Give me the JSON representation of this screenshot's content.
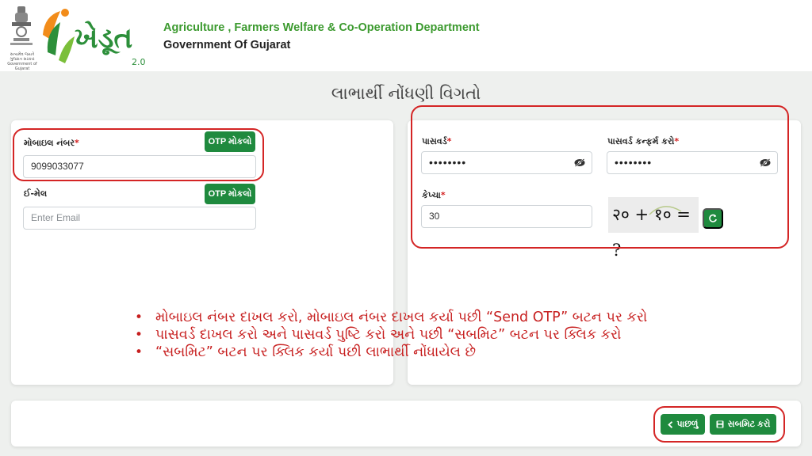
{
  "header": {
    "emblem_caption": "સત્યમેવ જયતે\nગુજરાત સરકાર\nGovernment of Gujarat",
    "logo_text": "ખેડૂત",
    "logo_version": "2.0",
    "department": "Agriculture , Farmers Welfare & Co-Operation Department",
    "government": "Government Of Gujarat"
  },
  "page": {
    "title": "લાભાર્થી નોંધણી વિગતો"
  },
  "form": {
    "mobile": {
      "label": "મોબાઇલ નંબર",
      "required_mark": "*",
      "value": "9099033077",
      "otp_button": "OTP મોકલો"
    },
    "email": {
      "label": "ઈ-મેલ",
      "placeholder": "Enter Email",
      "otp_button": "OTP મોકલો"
    },
    "password": {
      "label": "પાસવર્ડ",
      "required_mark": "*",
      "value": "••••••••"
    },
    "confirm_password": {
      "label": "પાસવર્ડ કન્ફર્મ કરો",
      "required_mark": "*",
      "value": "••••••••"
    },
    "captcha_answer": {
      "label": "કેપ્ચા",
      "required_mark": "*",
      "value": "30"
    },
    "captcha": {
      "text": "२० + १० = ?"
    }
  },
  "instructions": [
    "મોબાઇલ નંબર દાખલ કરો, મોબાઇલ નંબર દાખલ કર્યા પછી “Send OTP” બટન પર કરો",
    "પાસવર્ડ દાખલ કરો અને પાસવર્ડ પુષ્ટિ કરો અને પછી “સબમિટ” બટન પર ક્લિક કરો",
    "“સબમિટ”  બટન પર ક્લિક કર્યા પછી લાભાર્થી નોંધાયેલ છે"
  ],
  "actions": {
    "back_label": "પાછળું",
    "submit_label": "સબમિટ કરો"
  },
  "colors": {
    "primary_green": "#1f8a3e",
    "highlight_red": "#d42525",
    "header_green": "#3c9a2f"
  },
  "icons": [
    "emblem-icon",
    "eye-off-icon",
    "refresh-icon",
    "chevron-left-icon",
    "save-icon"
  ]
}
